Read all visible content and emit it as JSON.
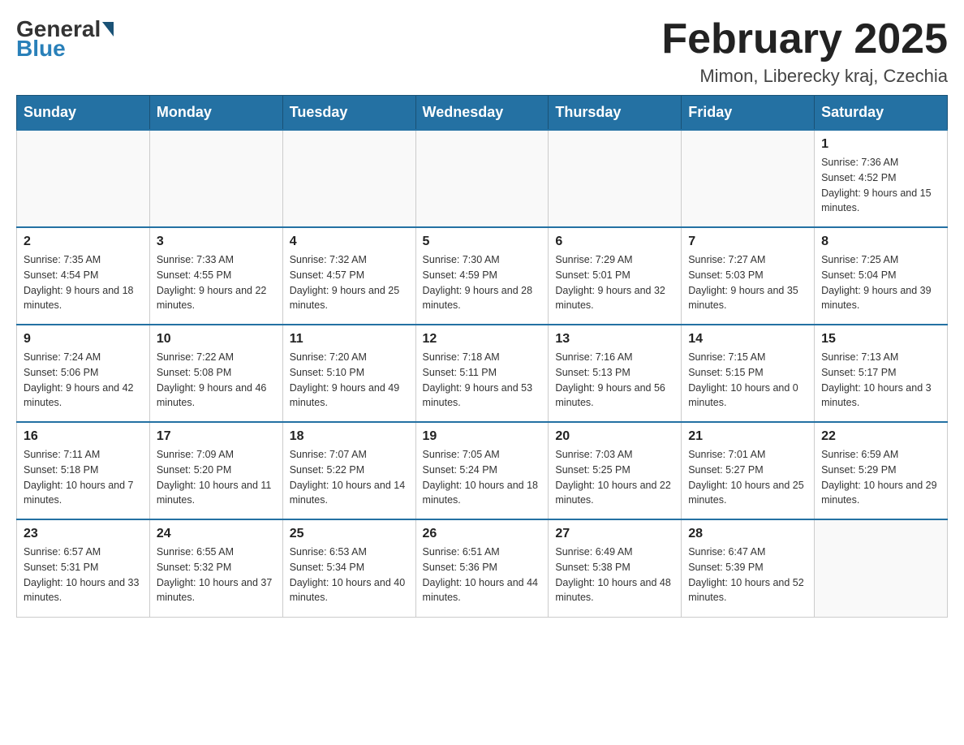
{
  "header": {
    "logo": {
      "general": "General",
      "blue": "Blue"
    },
    "title": "February 2025",
    "location": "Mimon, Liberecky kraj, Czechia"
  },
  "weekdays": [
    "Sunday",
    "Monday",
    "Tuesday",
    "Wednesday",
    "Thursday",
    "Friday",
    "Saturday"
  ],
  "weeks": [
    [
      {
        "day": "",
        "info": ""
      },
      {
        "day": "",
        "info": ""
      },
      {
        "day": "",
        "info": ""
      },
      {
        "day": "",
        "info": ""
      },
      {
        "day": "",
        "info": ""
      },
      {
        "day": "",
        "info": ""
      },
      {
        "day": "1",
        "info": "Sunrise: 7:36 AM\nSunset: 4:52 PM\nDaylight: 9 hours and 15 minutes."
      }
    ],
    [
      {
        "day": "2",
        "info": "Sunrise: 7:35 AM\nSunset: 4:54 PM\nDaylight: 9 hours and 18 minutes."
      },
      {
        "day": "3",
        "info": "Sunrise: 7:33 AM\nSunset: 4:55 PM\nDaylight: 9 hours and 22 minutes."
      },
      {
        "day": "4",
        "info": "Sunrise: 7:32 AM\nSunset: 4:57 PM\nDaylight: 9 hours and 25 minutes."
      },
      {
        "day": "5",
        "info": "Sunrise: 7:30 AM\nSunset: 4:59 PM\nDaylight: 9 hours and 28 minutes."
      },
      {
        "day": "6",
        "info": "Sunrise: 7:29 AM\nSunset: 5:01 PM\nDaylight: 9 hours and 32 minutes."
      },
      {
        "day": "7",
        "info": "Sunrise: 7:27 AM\nSunset: 5:03 PM\nDaylight: 9 hours and 35 minutes."
      },
      {
        "day": "8",
        "info": "Sunrise: 7:25 AM\nSunset: 5:04 PM\nDaylight: 9 hours and 39 minutes."
      }
    ],
    [
      {
        "day": "9",
        "info": "Sunrise: 7:24 AM\nSunset: 5:06 PM\nDaylight: 9 hours and 42 minutes."
      },
      {
        "day": "10",
        "info": "Sunrise: 7:22 AM\nSunset: 5:08 PM\nDaylight: 9 hours and 46 minutes."
      },
      {
        "day": "11",
        "info": "Sunrise: 7:20 AM\nSunset: 5:10 PM\nDaylight: 9 hours and 49 minutes."
      },
      {
        "day": "12",
        "info": "Sunrise: 7:18 AM\nSunset: 5:11 PM\nDaylight: 9 hours and 53 minutes."
      },
      {
        "day": "13",
        "info": "Sunrise: 7:16 AM\nSunset: 5:13 PM\nDaylight: 9 hours and 56 minutes."
      },
      {
        "day": "14",
        "info": "Sunrise: 7:15 AM\nSunset: 5:15 PM\nDaylight: 10 hours and 0 minutes."
      },
      {
        "day": "15",
        "info": "Sunrise: 7:13 AM\nSunset: 5:17 PM\nDaylight: 10 hours and 3 minutes."
      }
    ],
    [
      {
        "day": "16",
        "info": "Sunrise: 7:11 AM\nSunset: 5:18 PM\nDaylight: 10 hours and 7 minutes."
      },
      {
        "day": "17",
        "info": "Sunrise: 7:09 AM\nSunset: 5:20 PM\nDaylight: 10 hours and 11 minutes."
      },
      {
        "day": "18",
        "info": "Sunrise: 7:07 AM\nSunset: 5:22 PM\nDaylight: 10 hours and 14 minutes."
      },
      {
        "day": "19",
        "info": "Sunrise: 7:05 AM\nSunset: 5:24 PM\nDaylight: 10 hours and 18 minutes."
      },
      {
        "day": "20",
        "info": "Sunrise: 7:03 AM\nSunset: 5:25 PM\nDaylight: 10 hours and 22 minutes."
      },
      {
        "day": "21",
        "info": "Sunrise: 7:01 AM\nSunset: 5:27 PM\nDaylight: 10 hours and 25 minutes."
      },
      {
        "day": "22",
        "info": "Sunrise: 6:59 AM\nSunset: 5:29 PM\nDaylight: 10 hours and 29 minutes."
      }
    ],
    [
      {
        "day": "23",
        "info": "Sunrise: 6:57 AM\nSunset: 5:31 PM\nDaylight: 10 hours and 33 minutes."
      },
      {
        "day": "24",
        "info": "Sunrise: 6:55 AM\nSunset: 5:32 PM\nDaylight: 10 hours and 37 minutes."
      },
      {
        "day": "25",
        "info": "Sunrise: 6:53 AM\nSunset: 5:34 PM\nDaylight: 10 hours and 40 minutes."
      },
      {
        "day": "26",
        "info": "Sunrise: 6:51 AM\nSunset: 5:36 PM\nDaylight: 10 hours and 44 minutes."
      },
      {
        "day": "27",
        "info": "Sunrise: 6:49 AM\nSunset: 5:38 PM\nDaylight: 10 hours and 48 minutes."
      },
      {
        "day": "28",
        "info": "Sunrise: 6:47 AM\nSunset: 5:39 PM\nDaylight: 10 hours and 52 minutes."
      },
      {
        "day": "",
        "info": ""
      }
    ]
  ]
}
